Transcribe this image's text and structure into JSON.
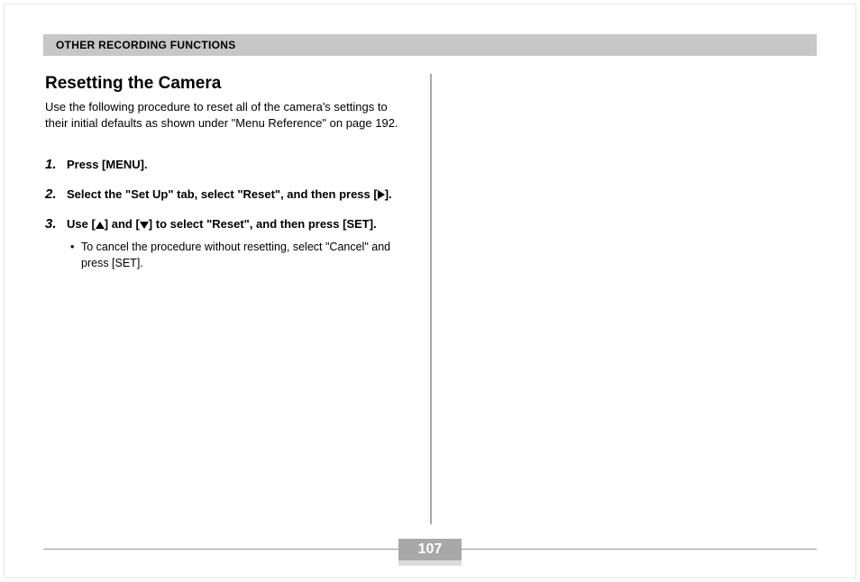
{
  "header": {
    "title": "OTHER RECORDING FUNCTIONS"
  },
  "section": {
    "heading": "Resetting the Camera",
    "intro": "Use the following procedure to reset all of the camera's settings to their initial defaults as shown under \"Menu Reference\" on page 192."
  },
  "steps": [
    {
      "num": "1.",
      "title_pre": "Press [MENU].",
      "title_mid": "",
      "title_post": "",
      "has_triangle_right": false,
      "has_triangles_updown": false,
      "sub": []
    },
    {
      "num": "2.",
      "title_pre": "Select the \"Set Up\" tab, select \"Reset\", and then press [",
      "title_mid": "",
      "title_post": "].",
      "has_triangle_right": true,
      "has_triangles_updown": false,
      "sub": []
    },
    {
      "num": "3.",
      "title_pre": "Use [",
      "title_mid": "] and [",
      "title_post": "] to select \"Reset\", and then press [SET].",
      "has_triangle_right": false,
      "has_triangles_updown": true,
      "sub": [
        "To cancel the procedure without resetting, select \"Cancel\" and press [SET]."
      ]
    }
  ],
  "page_number": "107"
}
